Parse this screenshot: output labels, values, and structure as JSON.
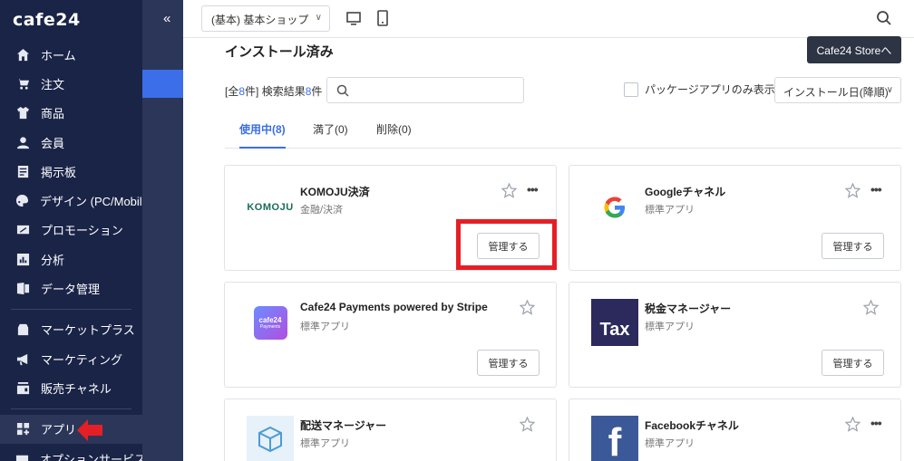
{
  "sidebar": {
    "logo": "cafe24",
    "collapse": "«",
    "items": [
      {
        "label": "ホーム",
        "icon": "home-icon"
      },
      {
        "label": "注文",
        "icon": "cart-icon"
      },
      {
        "label": "商品",
        "icon": "shirt-icon"
      },
      {
        "label": "会員",
        "icon": "user-icon"
      },
      {
        "label": "掲示板",
        "icon": "board-icon"
      },
      {
        "label": "デザイン (PC/Mobile)",
        "icon": "palette-icon"
      },
      {
        "label": "プロモーション",
        "icon": "promotion-icon"
      },
      {
        "label": "分析",
        "icon": "chart-icon"
      },
      {
        "label": "データ管理",
        "icon": "excel-icon"
      },
      {
        "label": "マーケットプラス",
        "icon": "market-icon"
      },
      {
        "label": "マーケティング",
        "icon": "megaphone-icon"
      },
      {
        "label": "販売チャネル",
        "icon": "channel-icon"
      },
      {
        "label": "アプリ",
        "icon": "apps-icon"
      },
      {
        "label": "オプションサービス",
        "icon": "option-icon"
      }
    ]
  },
  "header": {
    "shop_select": "(基本) 基本ショップ"
  },
  "main": {
    "title": "インストール済み",
    "store_button": "Cafe24 Storeへ",
    "count_prefix": "[全",
    "count_total": "8",
    "count_mid": "件] 検索結果",
    "count_result": "8",
    "count_suffix": "件",
    "search_placeholder": "",
    "package_only_label": "パッケージアプリのみ表示",
    "sort_value": "インストール日(降順)",
    "tabs": [
      {
        "label": "使用中(8)"
      },
      {
        "label": "満了(0)"
      },
      {
        "label": "削除(0)"
      }
    ],
    "cards": [
      {
        "name": "KOMOJU決済",
        "category": "金融/決済",
        "manage": "管理する",
        "logo_text": "KOMOJU"
      },
      {
        "name": "Googleチャネル",
        "category": "標準アプリ",
        "manage": "管理する",
        "logo_text": "G"
      },
      {
        "name": "Cafe24 Payments powered by Stripe",
        "category": "標準アプリ",
        "manage": "管理する",
        "logo_text": "cafe24",
        "logo_sub": "Payments"
      },
      {
        "name": "税金マネージャー",
        "category": "標準アプリ",
        "manage": "管理する",
        "logo_text": "Tax"
      },
      {
        "name": "配送マネージャー",
        "category": "標準アプリ",
        "manage": "",
        "logo_text": ""
      },
      {
        "name": "Facebookチャネル",
        "category": "標準アプリ",
        "manage": "",
        "logo_text": "f"
      }
    ]
  },
  "colors": {
    "sidebar_bg": "#1a2447",
    "accent": "#3b6ee8",
    "highlight": "#e51f25",
    "store_button_bg": "#2d3443"
  }
}
